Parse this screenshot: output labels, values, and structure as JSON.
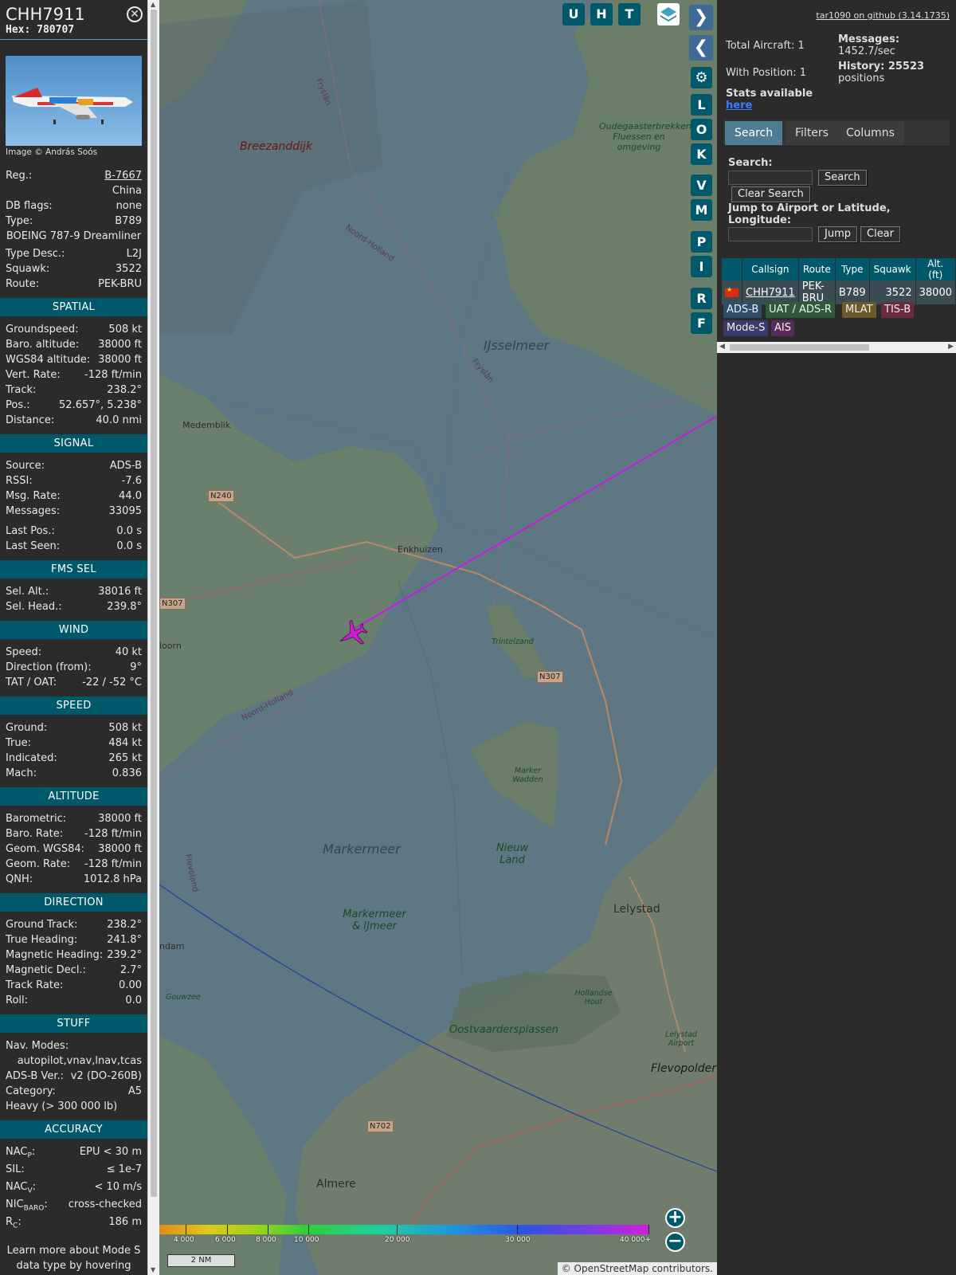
{
  "aircraft": {
    "callsign": "CHH7911",
    "hex_label": "Hex: 780707",
    "close_icon": "close-circle-icon",
    "image_credit": "Image © András Soós",
    "reg_label": "Reg.:",
    "reg_value": "B-7667",
    "country": "China",
    "db_flags_label": "DB flags:",
    "db_flags_value": "none",
    "type_label": "Type:",
    "type_value": "B789",
    "type_full": "BOEING 787-9 Dreamliner",
    "type_desc_label": "Type Desc.:",
    "type_desc_value": "L2J",
    "squawk_label": "Squawk:",
    "squawk_value": "3522",
    "route_label": "Route:",
    "route_value": "PEK-BRU"
  },
  "sections": {
    "spatial": {
      "title": "SPATIAL",
      "rows": [
        {
          "k": "Groundspeed:",
          "v": "508 kt"
        },
        {
          "k": "Baro. altitude:",
          "v": "38000 ft"
        },
        {
          "k": "WGS84 altitude:",
          "v": "38000 ft"
        },
        {
          "k": "Vert. Rate:",
          "v": "-128 ft/min"
        },
        {
          "k": "Track:",
          "v": "238.2°"
        },
        {
          "k": "Pos.:",
          "v": "52.657°, 5.238°"
        },
        {
          "k": "Distance:",
          "v": "40.0 nmi"
        }
      ]
    },
    "signal": {
      "title": "SIGNAL",
      "rows": [
        {
          "k": "Source:",
          "v": "ADS-B"
        },
        {
          "k": "RSSI:",
          "v": "-7.6"
        },
        {
          "k": "Msg. Rate:",
          "v": "44.0"
        },
        {
          "k": "Messages:",
          "v": "33095"
        },
        {
          "k": "Last Pos.:",
          "v": "0.0 s"
        },
        {
          "k": "Last Seen:",
          "v": "0.0 s"
        }
      ]
    },
    "fms": {
      "title": "FMS SEL",
      "rows": [
        {
          "k": "Sel. Alt.:",
          "v": "38016 ft"
        },
        {
          "k": "Sel. Head.:",
          "v": "239.8°"
        }
      ]
    },
    "wind": {
      "title": "WIND",
      "rows": [
        {
          "k": "Speed:",
          "v": "40 kt"
        },
        {
          "k": "Direction (from):",
          "v": "9°"
        },
        {
          "k": "TAT / OAT:",
          "v": "-22 / -52 °C"
        }
      ]
    },
    "speed": {
      "title": "SPEED",
      "rows": [
        {
          "k": "Ground:",
          "v": "508 kt"
        },
        {
          "k": "True:",
          "v": "484 kt"
        },
        {
          "k": "Indicated:",
          "v": "265 kt"
        },
        {
          "k": "Mach:",
          "v": "0.836"
        }
      ]
    },
    "altitude": {
      "title": "ALTITUDE",
      "rows": [
        {
          "k": "Barometric:",
          "v": "38000 ft"
        },
        {
          "k": "Baro. Rate:",
          "v": "-128 ft/min"
        },
        {
          "k": "Geom. WGS84:",
          "v": "38000 ft"
        },
        {
          "k": "Geom. Rate:",
          "v": "-128 ft/min"
        },
        {
          "k": "QNH:",
          "v": "1012.8 hPa"
        }
      ]
    },
    "direction": {
      "title": "DIRECTION",
      "rows": [
        {
          "k": "Ground Track:",
          "v": "238.2°"
        },
        {
          "k": "True Heading:",
          "v": "241.8°"
        },
        {
          "k": "Magnetic Heading:",
          "v": "239.2°"
        },
        {
          "k": "Magnetic Decl.:",
          "v": "2.7°"
        },
        {
          "k": "Track Rate:",
          "v": "0.00"
        },
        {
          "k": "Roll:",
          "v": "0.0"
        }
      ]
    },
    "stuff": {
      "title": "STUFF",
      "nav_modes_label": "Nav. Modes:",
      "nav_modes_value": "autopilot,vnav,lnav,tcas",
      "adsb_ver_label": "ADS-B Ver.:",
      "adsb_ver_value": "v2 (DO-260B)",
      "category_label": "Category:",
      "category_value": "A5",
      "category_desc": "Heavy (> 300 000 lb)"
    },
    "accuracy": {
      "title": "ACCURACY",
      "rows": [
        {
          "k": "NACP:",
          "v": "EPU < 30 m"
        },
        {
          "k": "SIL:",
          "v": "≤ 1e-7"
        },
        {
          "k": "NACV:",
          "v": "< 10 m/s"
        },
        {
          "k": "NICBARO:",
          "v": "cross-checked"
        },
        {
          "k": "RC:",
          "v": "186 m"
        }
      ],
      "hint": "Learn more about Mode S data type by hovering over each data label."
    }
  },
  "map": {
    "buttons": [
      "U",
      "H",
      "T",
      "L",
      "O",
      "K",
      "V",
      "M",
      "P",
      "I",
      "R",
      "F"
    ],
    "labels": {
      "breezanddijk": "Breezanddijk",
      "ijsselmeer": "IJsselmeer",
      "markermeer": "Markermeer",
      "markermeer_ij": "Markermeer & IJmeer",
      "nieuw_land": "Nieuw Land",
      "oudegaasterbrekken": "Oudegaasterbrekken Fluessen en omgeving",
      "marker_wadden": "Marker Wadden",
      "oostvaardersplassen": "Oostvaardersplassen",
      "flevopolder": "Flevopolder",
      "medemblik": "Medemblik",
      "enkhuizen": "Enkhuizen",
      "lelystad": "Lelystad",
      "almere": "Almere",
      "trintelzand": "Trintelzand",
      "lelystad_airport": "Lelystad Airport",
      "hollandse_hout": "Hollandse Hout",
      "hoorn_partial": "loorn",
      "dam_partial": "ndam",
      "gouwzee": "Gouwzee",
      "n240": "N240",
      "n307_left": "N307",
      "n307_right": "N307",
      "n702": "N702",
      "noord_holland_1": "Noord-Holland",
      "noord_holland_2": "Noord-Holland",
      "fryslan_1": "Fryslân",
      "fryslan_2": "Fryslân",
      "flevoland": "Flevoland"
    },
    "alt_legend_ticks": [
      "4 000",
      "6 000",
      "8 000",
      "10 000",
      "20 000",
      "30 000",
      "40 000+"
    ],
    "scale": "2 NM",
    "attribution_prefix": "© ",
    "attribution_link": "OpenStreetMap",
    "attribution_suffix": " contributors.",
    "zoom_in": "+",
    "zoom_out": "−",
    "track_color": "#c01ee0",
    "plane_color": "#d41ad4"
  },
  "right": {
    "github_link": "tar1090 on github (3.14.1735)",
    "total_aircraft": "Total Aircraft: 1",
    "with_position": "With Position: 1",
    "stats_available": "Stats available",
    "here_link": "here",
    "messages_label": "Messages:",
    "messages_value": "1452.7/sec",
    "history_label": "History: 25523",
    "history_value": "positions",
    "tabs": [
      "Search",
      "Filters",
      "Columns"
    ],
    "search_label": "Search:",
    "search_button": "Search",
    "clear_search_button": "Clear Search",
    "jump_label": "Jump to Airport or Latitude, Longitude:",
    "jump_button": "Jump",
    "clear_button": "Clear",
    "table_headers": [
      "",
      "Callsign",
      "Route",
      "Type",
      "Squawk",
      "Alt. (ft)"
    ],
    "table_row": {
      "flag": "china-flag-icon",
      "callsign": "CHH7911",
      "route": "PEK-BRU",
      "type": "B789",
      "squawk": "3522",
      "alt": "38000"
    },
    "sources": [
      {
        "label": "ADS-B",
        "color": "#2d4e6e"
      },
      {
        "label": "UAT / ADS-R",
        "color": "#2f5a3a"
      },
      {
        "label": "MLAT",
        "color": "#6b5a2a"
      },
      {
        "label": "TIS-B",
        "color": "#6b2a3e"
      },
      {
        "label": "Mode-S",
        "color": "#3a3a6b"
      },
      {
        "label": "AIS",
        "color": "#5a2a5a"
      }
    ]
  }
}
